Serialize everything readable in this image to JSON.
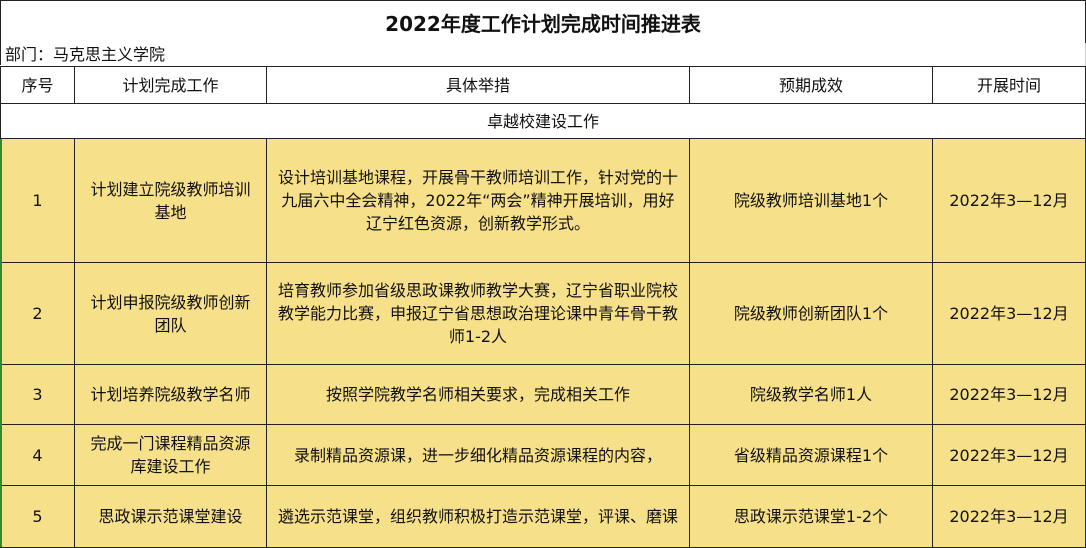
{
  "title": "2022年度工作计划完成时间推进表",
  "department": "部门：马克思主义学院",
  "headers": [
    "序号",
    "计划完成工作",
    "具体举措",
    "预期成效",
    "开展时间"
  ],
  "section": "卓越校建设工作",
  "rows": [
    {
      "no": "1",
      "work": "计划建立院级教师培训基地",
      "measures": "设计培训基地课程，开展骨干教师培训工作，针对党的十九届六中全会精神，2022年“两会”精神开展培训，用好辽宁红色资源，创新教学形式。",
      "effect": "院级教师培训基地1个",
      "time": "2022年3—12月"
    },
    {
      "no": "2",
      "work": "计划申报院级教师创新团队",
      "measures": "培育教师参加省级思政课教师教学大赛，辽宁省职业院校教学能力比赛，申报辽宁省思想政治理论课中青年骨干教师1-2人",
      "effect": "院级教师创新团队1个",
      "time": "2022年3—12月"
    },
    {
      "no": "3",
      "work": "计划培养院级教学名师",
      "measures": "按照学院教学名师相关要求，完成相关工作",
      "effect": "院级教学名师1人",
      "time": "2022年3—12月"
    },
    {
      "no": "4",
      "work": "完成一门课程精品资源库建设工作",
      "measures": "录制精品资源课，进一步细化精品资源课程的内容，",
      "effect": "省级精品资源课程1个",
      "time": "2022年3—12月"
    },
    {
      "no": "5",
      "work": "思政课示范课堂建设",
      "measures": "遴选示范课堂，组织教师积极打造示范课堂，评课、磨课",
      "effect": "思政课示范课堂1-2个",
      "time": "2022年3—12月"
    }
  ],
  "colors": {
    "row_fill": "#f7e08a",
    "border": "#222222"
  }
}
